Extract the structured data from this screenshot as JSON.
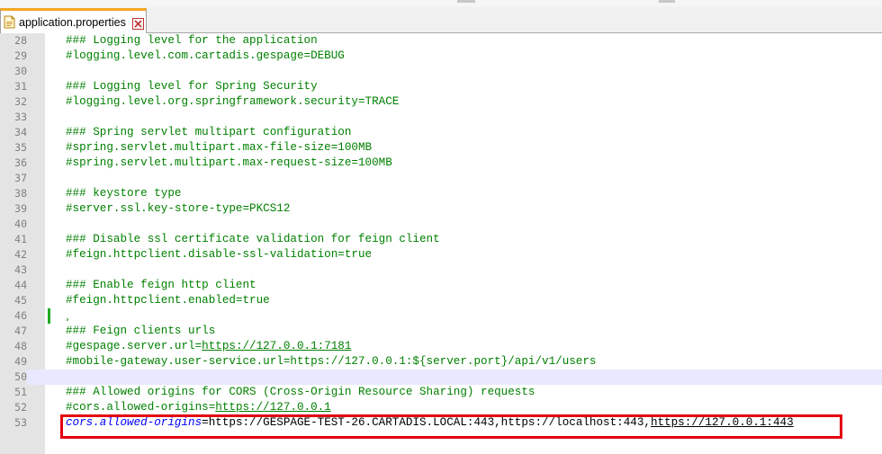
{
  "tab": {
    "title": "application.properties",
    "file_icon": "file-icon",
    "close_icon": "close-icon"
  },
  "colors": {
    "comment": "#008000",
    "key": "#0000ff",
    "highlight_border": "#e3000f",
    "change_marker": "#22aa22",
    "tab_accent": "#f5a623"
  },
  "editor": {
    "lines": [
      {
        "num": "28",
        "text": "### Logging level for the application"
      },
      {
        "num": "29",
        "text": "#logging.level.com.cartadis.gespage=DEBUG"
      },
      {
        "num": "30",
        "text": ""
      },
      {
        "num": "31",
        "text": "### Logging level for Spring Security"
      },
      {
        "num": "32",
        "text": "#logging.level.org.springframework.security=TRACE"
      },
      {
        "num": "33",
        "text": ""
      },
      {
        "num": "34",
        "text": "### Spring servlet multipart configuration"
      },
      {
        "num": "35",
        "text": "#spring.servlet.multipart.max-file-size=100MB"
      },
      {
        "num": "36",
        "text": "#spring.servlet.multipart.max-request-size=100MB"
      },
      {
        "num": "37",
        "text": ""
      },
      {
        "num": "38",
        "text": "### keystore type"
      },
      {
        "num": "39",
        "text": "#server.ssl.key-store-type=PKCS12"
      },
      {
        "num": "40",
        "text": ""
      },
      {
        "num": "41",
        "text": "### Disable ssl certificate validation for feign client"
      },
      {
        "num": "42",
        "text": "#feign.httpclient.disable-ssl-validation=true"
      },
      {
        "num": "43",
        "text": ""
      },
      {
        "num": "44",
        "text": "### Enable feign http client"
      },
      {
        "num": "45",
        "text": "#feign.httpclient.enabled=true"
      },
      {
        "num": "46",
        "text": "¸"
      },
      {
        "num": "47",
        "text": "### Feign clients urls"
      },
      {
        "num": "48",
        "text_prefix": "#gespage.server.url=",
        "text_url": "https://127.0.0.1:7181"
      },
      {
        "num": "49",
        "text": "#mobile-gateway.user-service.url=https://127.0.0.1:${server.port}/api/v1/users"
      },
      {
        "num": "50",
        "text": ""
      },
      {
        "num": "51",
        "text": "### Allowed origins for CORS (Cross-Origin Resource Sharing) requests"
      },
      {
        "num": "52",
        "text_prefix": "#cors.allowed-origins=",
        "text_url": "https://127.0.0.1"
      },
      {
        "num": "53",
        "key": "cors.allowed-origins",
        "value_plain": "=https://GESPAGE-TEST-26.CARTADIS.LOCAL:443,https://localhost:443,",
        "value_url": "https://127.0.0.1:443"
      }
    ]
  }
}
